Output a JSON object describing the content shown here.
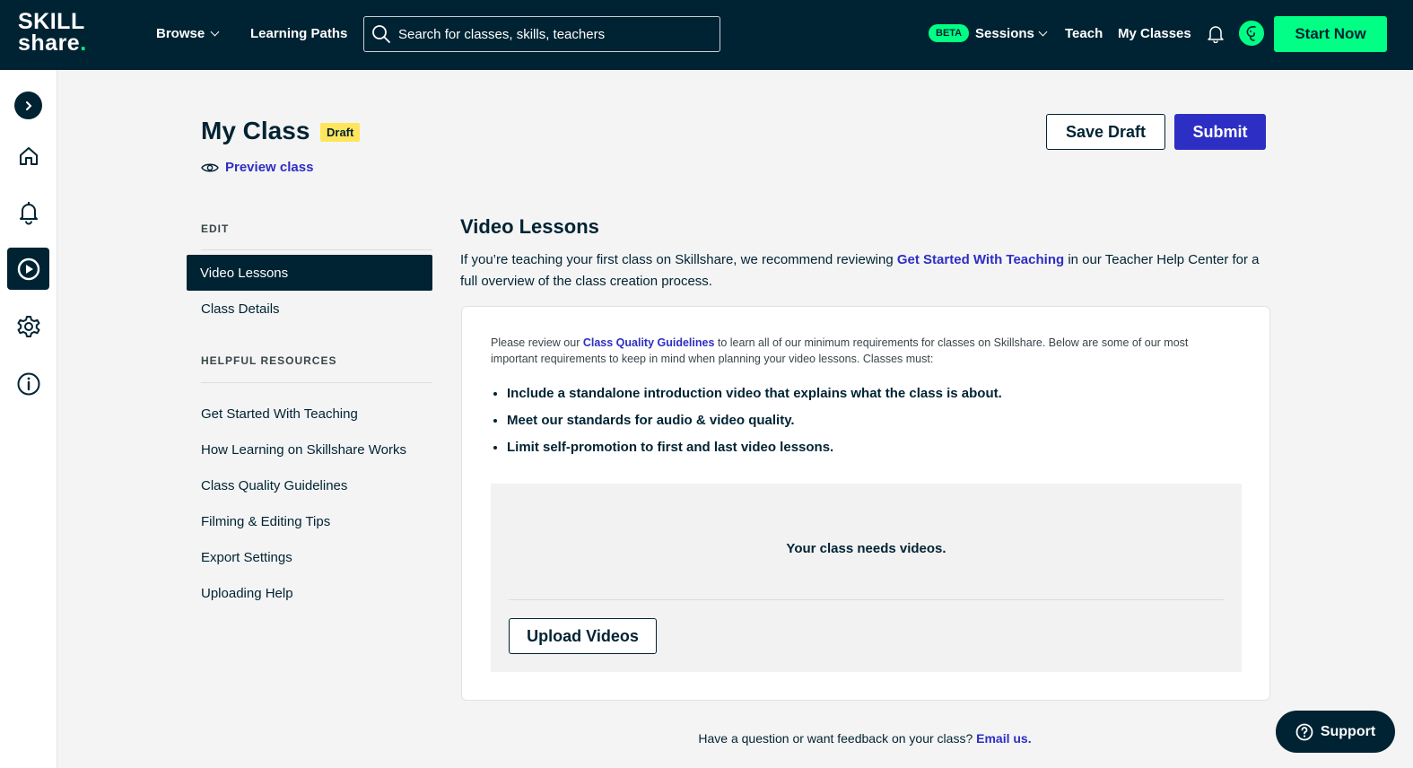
{
  "brand": {
    "logo_line1": "SKILL",
    "logo_line2": "share",
    "logo_dot": "."
  },
  "nav": {
    "browse": "Browse",
    "learning_paths": "Learning Paths",
    "search_placeholder": "Search for classes, skills, teachers",
    "beta_badge": "BETA",
    "sessions": "Sessions",
    "teach": "Teach",
    "my_classes": "My Classes",
    "start_now": "Start Now"
  },
  "rail": {
    "items": [
      "expand-icon",
      "home-icon",
      "bell-icon",
      "play-circle-icon",
      "gear-icon",
      "info-icon"
    ],
    "active": "play-circle-icon"
  },
  "header": {
    "title": "My Class",
    "status_badge": "Draft",
    "preview_link": "Preview class",
    "save_draft": "Save Draft",
    "submit": "Submit"
  },
  "sidebar": {
    "edit_label": "EDIT",
    "edit_items": [
      {
        "label": "Video Lessons",
        "active": true
      },
      {
        "label": "Class Details",
        "active": false
      }
    ],
    "resources_label": "HELPFUL RESOURCES",
    "resources": [
      "Get Started With Teaching",
      "How Learning on Skillshare Works",
      "Class Quality Guidelines",
      "Filming & Editing Tips",
      "Export Settings",
      "Uploading Help"
    ]
  },
  "main": {
    "title": "Video Lessons",
    "intro_before": "If you’re teaching your first class on Skillshare, we recommend reviewing ",
    "intro_link": "Get Started With Teaching",
    "intro_after": " in our Teacher Help Center for a full overview of the class creation process.",
    "note_before": "Please review our ",
    "note_link": "Class Quality Guidelines",
    "note_after": " to learn all of our minimum requirements for classes on Skillshare. Below are some of our most important requirements to keep in mind when planning your video lessons. Classes must:",
    "requirements": [
      "Include a standalone introduction video that explains what the class is about.",
      "Meet our standards for audio & video quality.",
      "Limit self-promotion to first and last video lessons."
    ],
    "empty_state": "Your class needs videos.",
    "upload_button": "Upload Videos"
  },
  "footer": {
    "question": "Have a question or want feedback on your class? ",
    "email_link": "Email us."
  },
  "support": {
    "label": "Support"
  },
  "colors": {
    "navy": "#002333",
    "accent_green": "#00ff84",
    "link_blue": "#2d2ec4",
    "draft_yellow": "#ffe55c"
  }
}
